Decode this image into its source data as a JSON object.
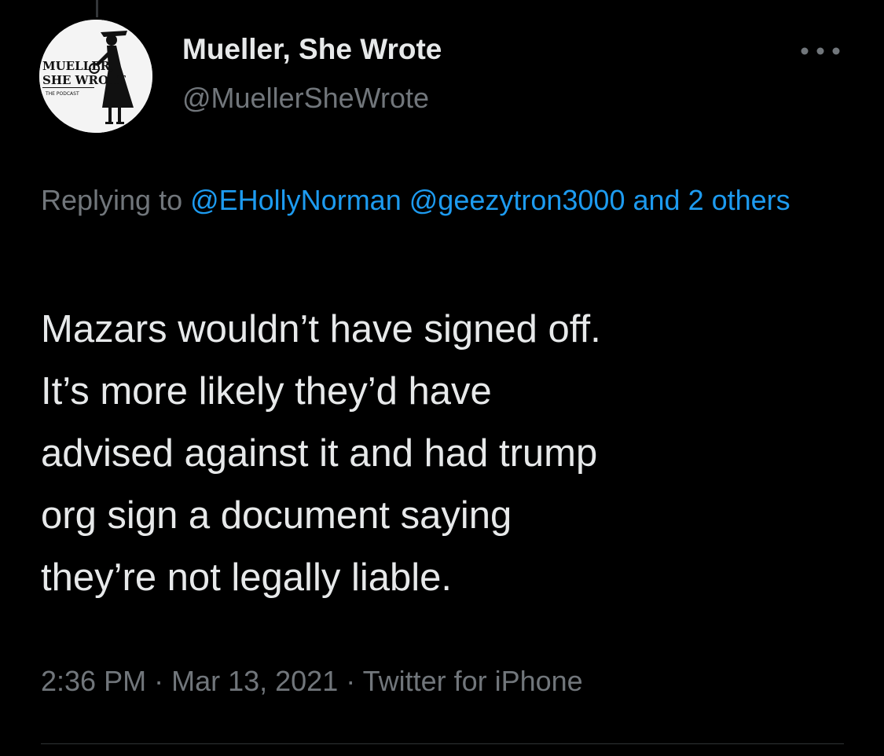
{
  "author": {
    "display_name": "Mueller, She Wrote",
    "handle": "@MuellerSheWrote",
    "avatar_logo_text": [
      "MUELLER,",
      "SHE WROTE",
      "THE PODCAST"
    ]
  },
  "more_icon": "more-horizontal-icon",
  "reply_context": {
    "prefix": "Replying to ",
    "mention_1": "@EHollyNorman",
    "mention_2": "@geezytron3000",
    "and_others": "and 2 others"
  },
  "tweet": {
    "text": "Mazars wouldn’t have signed off.\nIt’s more likely they’d have\nadvised against it and had trump\norg sign a document saying\nthey’re not legally liable."
  },
  "meta": {
    "time": "2:36 PM",
    "date": "Mar 13, 2021",
    "source": "Twitter for iPhone",
    "separator": " · "
  },
  "colors": {
    "background": "#000000",
    "primary_text": "#e7e9ea",
    "secondary_text": "#71767b",
    "link": "#1d9bf0"
  }
}
